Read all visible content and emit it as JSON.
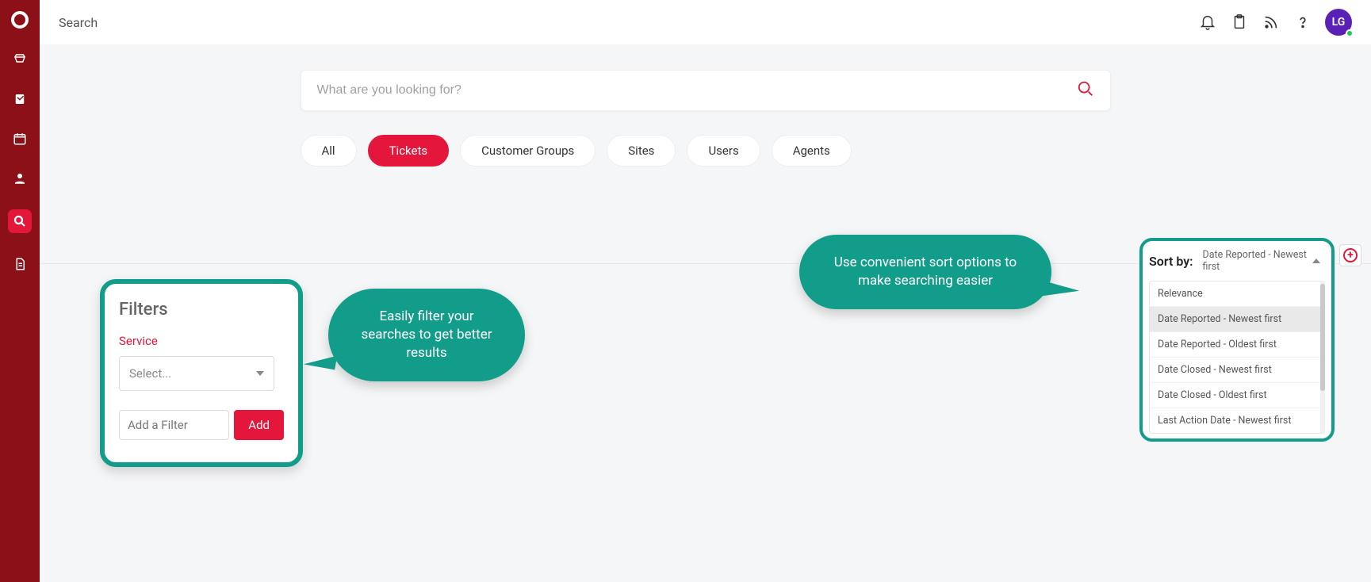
{
  "colors": {
    "accent": "#e5163c",
    "teal": "#129c8a",
    "rail": "#8b1017",
    "avatar": "#5b21b6"
  },
  "header": {
    "title": "Search",
    "avatar_initials": "LG"
  },
  "search": {
    "placeholder": "What are you looking for?"
  },
  "tabs": [
    "All",
    "Tickets",
    "Customer Groups",
    "Sites",
    "Users",
    "Agents"
  ],
  "active_tab": 1,
  "sort": {
    "label": "Sort by:",
    "selected": "Date Reported - Newest first",
    "options": [
      "Relevance",
      "Date Reported - Newest first",
      "Date Reported - Oldest first",
      "Date Closed - Newest first",
      "Date Closed - Oldest first",
      "Last Action Date - Newest first"
    ]
  },
  "filters": {
    "title": "Filters",
    "group_label": "Service",
    "select_placeholder": "Select...",
    "add_filter_placeholder": "Add a Filter",
    "add_button": "Add"
  },
  "callouts": {
    "left": "Easily filter your searches to get better results",
    "right": "Use convenient sort options to make searching easier"
  },
  "rail_icons": [
    "logo",
    "ticket",
    "note",
    "calendar",
    "user",
    "search",
    "document"
  ]
}
